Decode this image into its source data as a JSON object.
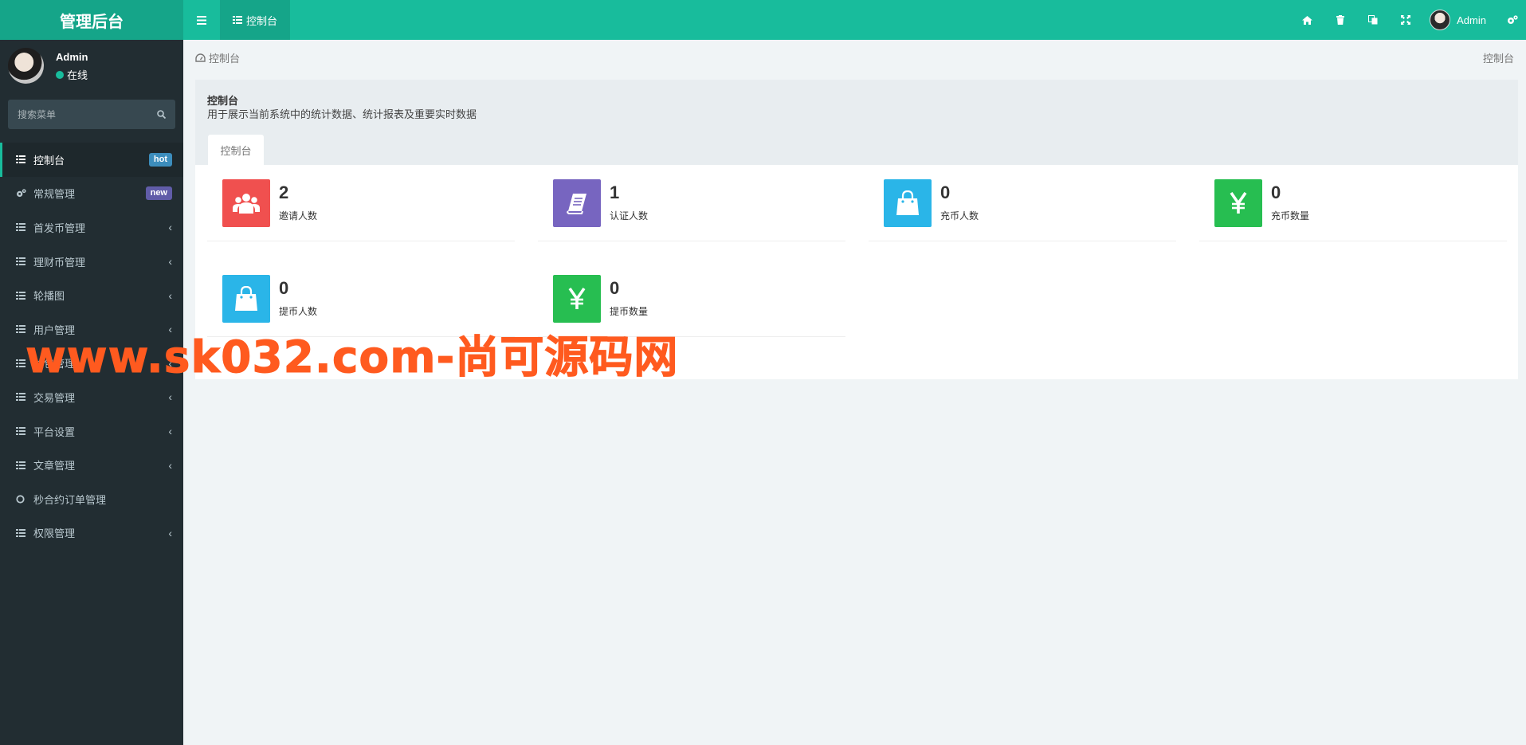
{
  "app": {
    "title": "管理后台"
  },
  "topbar": {
    "tab_label": "控制台",
    "user_name": "Admin"
  },
  "user": {
    "name": "Admin",
    "status": "在线"
  },
  "search": {
    "placeholder": "搜索菜单"
  },
  "menu": [
    {
      "label": "控制台",
      "icon": "list-icon",
      "badge": "hot",
      "badge_color": "#3c8dbc",
      "active": true
    },
    {
      "label": "常规管理",
      "icon": "cogs-icon",
      "badge": "new",
      "badge_color": "#605ca8"
    },
    {
      "label": "首发币管理",
      "icon": "list-icon",
      "chevron": true
    },
    {
      "label": "理财币管理",
      "icon": "list-icon",
      "chevron": true
    },
    {
      "label": "轮播图",
      "icon": "list-icon",
      "chevron": true
    },
    {
      "label": "用户管理",
      "icon": "list-icon",
      "chevron": true
    },
    {
      "label": "钱包管理",
      "icon": "list-icon",
      "chevron": true
    },
    {
      "label": "交易管理",
      "icon": "list-icon",
      "chevron": true
    },
    {
      "label": "平台设置",
      "icon": "list-icon",
      "chevron": true
    },
    {
      "label": "文章管理",
      "icon": "list-icon",
      "chevron": true
    },
    {
      "label": "秒合约订单管理",
      "icon": "circle-icon"
    },
    {
      "label": "权限管理",
      "icon": "list-icon",
      "chevron": true
    }
  ],
  "breadcrumb": {
    "left": "控制台",
    "right": "控制台"
  },
  "panel": {
    "title": "控制台",
    "description": "用于展示当前系统中的统计数据、统计报表及重要实时数据",
    "tab": "控制台"
  },
  "stats": [
    {
      "value": "2",
      "label": "邀请人数",
      "color": "#f0504f",
      "icon": "users-icon"
    },
    {
      "value": "1",
      "label": "认证人数",
      "color": "#7765c0",
      "icon": "book-icon"
    },
    {
      "value": "0",
      "label": "充币人数",
      "color": "#2ab5e8",
      "icon": "shopping-bag-icon"
    },
    {
      "value": "0",
      "label": "充币数量",
      "color": "#27be51",
      "icon": "yen-icon"
    },
    {
      "value": "0",
      "label": "提币人数",
      "color": "#2ab5e8",
      "icon": "shopping-bag-icon"
    },
    {
      "value": "0",
      "label": "提币数量",
      "color": "#27be51",
      "icon": "yen-icon"
    }
  ],
  "watermark": "www.sk032.com-尚可源码网"
}
